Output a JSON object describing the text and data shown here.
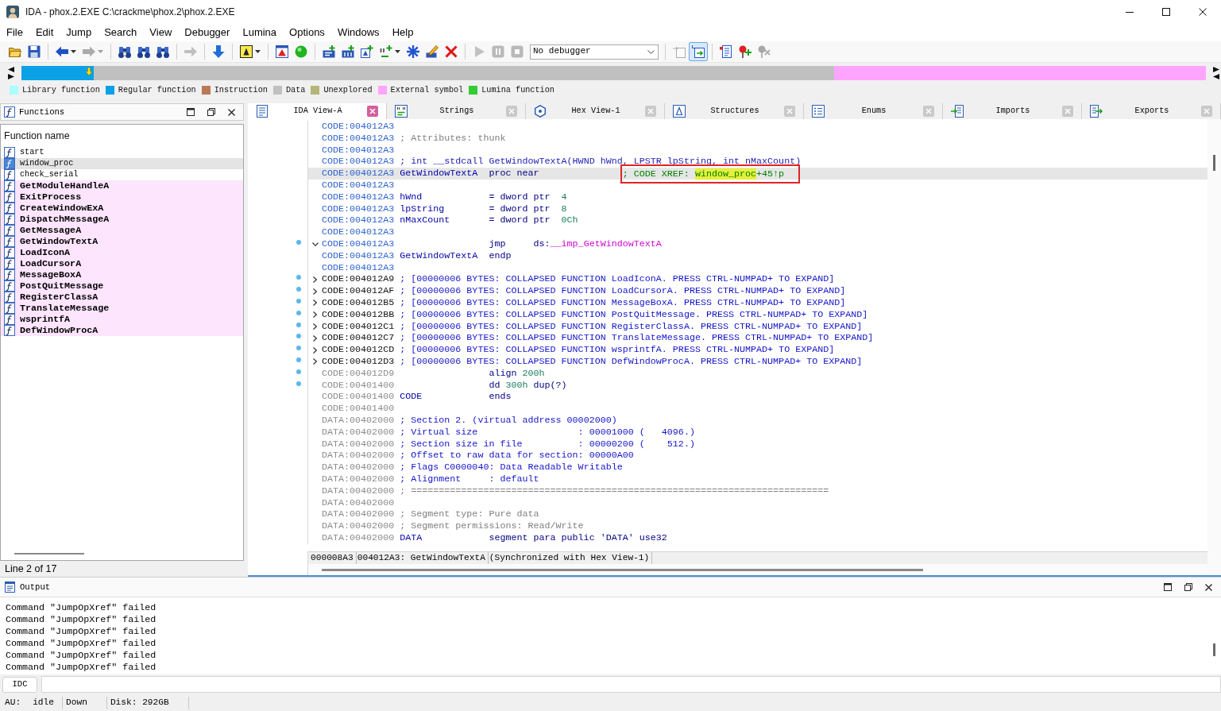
{
  "window": {
    "title": "IDA - phox.2.EXE C:\\crackme\\phox.2\\phox.2.EXE"
  },
  "menu": [
    "File",
    "Edit",
    "Jump",
    "Search",
    "View",
    "Debugger",
    "Lumina",
    "Options",
    "Windows",
    "Help"
  ],
  "toolbar": [
    {
      "kind": "open",
      "disabled": false,
      "pressed": false,
      "dropdown": false
    },
    {
      "kind": "save",
      "disabled": false,
      "pressed": false,
      "dropdown": false
    },
    {
      "kind": "separator"
    },
    {
      "kind": "back",
      "disabled": false,
      "pressed": false,
      "dropdown": true
    },
    {
      "kind": "forward",
      "disabled": true,
      "pressed": false,
      "dropdown": true
    },
    {
      "kind": "separator"
    },
    {
      "kind": "immsearch",
      "disabled": false,
      "pressed": false,
      "dropdown": false
    },
    {
      "kind": "textsearch",
      "disabled": false,
      "pressed": false,
      "dropdown": false
    },
    {
      "kind": "binsearch",
      "disabled": false,
      "pressed": false,
      "dropdown": false
    },
    {
      "kind": "separator"
    },
    {
      "kind": "goto",
      "disabled": true,
      "pressed": false,
      "dropdown": false
    },
    {
      "kind": "separator"
    },
    {
      "kind": "descend",
      "disabled": false,
      "pressed": false,
      "dropdown": false
    },
    {
      "kind": "separator"
    },
    {
      "kind": "rename",
      "disabled": false,
      "pressed": false,
      "dropdown": true
    },
    {
      "kind": "separator"
    },
    {
      "kind": "problems",
      "disabled": false,
      "pressed": false,
      "dropdown": false
    },
    {
      "kind": "status",
      "disabled": false,
      "pressed": false,
      "dropdown": false
    },
    {
      "kind": "separator"
    },
    {
      "kind": "code",
      "disabled": false,
      "pressed": false,
      "dropdown": false
    },
    {
      "kind": "data",
      "disabled": false,
      "pressed": false,
      "dropdown": false
    },
    {
      "kind": "alignment",
      "disabled": false,
      "pressed": false,
      "dropdown": false
    },
    {
      "kind": "strlit",
      "disabled": false,
      "pressed": false,
      "dropdown": true
    },
    {
      "kind": "array",
      "disabled": false,
      "pressed": false,
      "dropdown": false
    },
    {
      "kind": "edit",
      "disabled": false,
      "pressed": false,
      "dropdown": false
    },
    {
      "kind": "undefine",
      "disabled": false,
      "pressed": false,
      "dropdown": false
    },
    {
      "kind": "separator"
    },
    {
      "kind": "run",
      "disabled": true,
      "pressed": false,
      "dropdown": false
    },
    {
      "kind": "pause",
      "disabled": true,
      "pressed": false,
      "dropdown": false
    },
    {
      "kind": "stop",
      "disabled": true,
      "pressed": false,
      "dropdown": false
    },
    {
      "kind": "combo",
      "value": "No debugger"
    },
    {
      "kind": "separator"
    },
    {
      "kind": "source",
      "disabled": true,
      "pressed": false,
      "dropdown": false
    },
    {
      "kind": "sync",
      "disabled": false,
      "pressed": true,
      "dropdown": false
    },
    {
      "kind": "separator"
    },
    {
      "kind": "list",
      "disabled": false,
      "pressed": false,
      "dropdown": false
    },
    {
      "kind": "addbreak",
      "disabled": false,
      "pressed": false,
      "dropdown": false
    },
    {
      "kind": "delbreak",
      "disabled": true,
      "pressed": false,
      "dropdown": false
    }
  ],
  "legend": [
    {
      "label": "Library function",
      "color": "#aaffff"
    },
    {
      "label": "Regular function",
      "color": "#0aa1e6"
    },
    {
      "label": "Instruction",
      "color": "#b97a57"
    },
    {
      "label": "Data",
      "color": "#c0c0c0"
    },
    {
      "label": "Unexplored",
      "color": "#b5b57a"
    },
    {
      "label": "External symbol",
      "color": "#ffa5ff"
    },
    {
      "label": "Lumina function",
      "color": "#32cd32"
    }
  ],
  "functions_panel": {
    "title": "Functions",
    "column": "Function name",
    "rows": [
      {
        "name": "start",
        "kind": "regular",
        "selected": false
      },
      {
        "name": "window_proc",
        "kind": "regular",
        "selected": true
      },
      {
        "name": "check_serial",
        "kind": "regular",
        "selected": false
      },
      {
        "name": "GetModuleHandleA",
        "kind": "external",
        "selected": false
      },
      {
        "name": "ExitProcess",
        "kind": "external",
        "selected": false
      },
      {
        "name": "CreateWindowExA",
        "kind": "external",
        "selected": false
      },
      {
        "name": "DispatchMessageA",
        "kind": "external",
        "selected": false
      },
      {
        "name": "GetMessageA",
        "kind": "external",
        "selected": false
      },
      {
        "name": "GetWindowTextA",
        "kind": "external",
        "selected": false
      },
      {
        "name": "LoadIconA",
        "kind": "external",
        "selected": false
      },
      {
        "name": "LoadCursorA",
        "kind": "external",
        "selected": false
      },
      {
        "name": "MessageBoxA",
        "kind": "external",
        "selected": false
      },
      {
        "name": "PostQuitMessage",
        "kind": "external",
        "selected": false
      },
      {
        "name": "RegisterClassA",
        "kind": "external",
        "selected": false
      },
      {
        "name": "TranslateMessage",
        "kind": "external",
        "selected": false
      },
      {
        "name": "wsprintfA",
        "kind": "external",
        "selected": false
      },
      {
        "name": "DefWindowProcA",
        "kind": "external",
        "selected": false
      }
    ],
    "status": "Line 2 of 17"
  },
  "tabs": [
    {
      "label": "IDA View-A",
      "kind": "disassembly",
      "selected": true
    },
    {
      "label": "Strings",
      "kind": "strings",
      "selected": false
    },
    {
      "label": "Hex View-1",
      "kind": "hex",
      "selected": false
    },
    {
      "label": "Structures",
      "kind": "structures",
      "selected": false
    },
    {
      "label": "Enums",
      "kind": "enums",
      "selected": false
    },
    {
      "label": "Imports",
      "kind": "imports",
      "selected": false
    },
    {
      "label": "Exports",
      "kind": "exports",
      "selected": false
    }
  ],
  "listing": {
    "lines": [
      {
        "address": "CODE:004012A3",
        "kind": "function",
        "selected": false,
        "marker": false
      },
      {
        "address": "CODE:004012A3",
        "kind": "function",
        "selected": false,
        "marker": false,
        "note": [
          {
            "text": "; Attributes: thunk",
            "kind": "comment"
          }
        ]
      },
      {
        "address": "CODE:004012A3",
        "kind": "function",
        "selected": false,
        "marker": false
      },
      {
        "address": "CODE:004012A3",
        "kind": "function",
        "selected": false,
        "marker": false,
        "note": [
          {
            "text": "; int __stdcall GetWindowTextA(HWND hWnd, LPSTR lpString, int nMaxCount)",
            "kind": "prototype"
          }
        ]
      },
      {
        "address": "CODE:004012A3",
        "kind": "function",
        "selected": true,
        "marker": false,
        "label": "GetWindowTextA",
        "code": [
          {
            "text": "proc near",
            "kind": "keyword"
          }
        ],
        "comment": {
          "boxed": true,
          "tokens": [
            {
              "text": "; CODE XREF: ",
              "kind": "xref",
              "highlighted": false
            },
            {
              "text": "window_proc",
              "kind": "xref",
              "highlighted": true
            },
            {
              "text": "+45↑p",
              "kind": "xref",
              "highlighted": false
            }
          ]
        }
      },
      {
        "address": "CODE:004012A3",
        "kind": "function",
        "selected": false,
        "marker": false
      },
      {
        "address": "CODE:004012A3",
        "kind": "function",
        "selected": false,
        "marker": false,
        "label": "hWnd",
        "code": [
          {
            "text": "= dword ptr  ",
            "kind": "keyword"
          },
          {
            "text": "4",
            "kind": "number"
          }
        ]
      },
      {
        "address": "CODE:004012A3",
        "kind": "function",
        "selected": false,
        "marker": false,
        "label": "lpString",
        "code": [
          {
            "text": "= dword ptr  ",
            "kind": "keyword"
          },
          {
            "text": "8",
            "kind": "number"
          }
        ]
      },
      {
        "address": "CODE:004012A3",
        "kind": "function",
        "selected": false,
        "marker": false,
        "label": "nMaxCount",
        "code": [
          {
            "text": "= dword ptr  ",
            "kind": "keyword"
          },
          {
            "text": "0Ch",
            "kind": "number"
          }
        ]
      },
      {
        "address": "CODE:004012A3",
        "kind": "function",
        "selected": false,
        "marker": false
      },
      {
        "address": "CODE:004012A3",
        "kind": "function",
        "selected": false,
        "marker": true,
        "expanded": true,
        "code": [
          {
            "text": "jmp     ds:",
            "kind": "keyword"
          },
          {
            "text": "__imp_GetWindowTextA",
            "kind": "import"
          }
        ]
      },
      {
        "address": "CODE:004012A3",
        "kind": "function",
        "selected": false,
        "marker": false,
        "label": "GetWindowTextA",
        "code": [
          {
            "text": "endp",
            "kind": "keyword"
          }
        ]
      },
      {
        "address": "CODE:004012A3",
        "kind": "function",
        "selected": false,
        "marker": false
      },
      {
        "address": "CODE:004012A9",
        "kind": "collapsed",
        "selected": false,
        "marker": true,
        "expanded": false,
        "note": [
          {
            "text": "; [00000006 BYTES: COLLAPSED FUNCTION LoadIconA. PRESS CTRL-NUMPAD+ TO EXPAND]",
            "kind": "collapsed"
          }
        ]
      },
      {
        "address": "CODE:004012AF",
        "kind": "collapsed",
        "selected": false,
        "marker": true,
        "expanded": false,
        "note": [
          {
            "text": "; [00000006 BYTES: COLLAPSED FUNCTION LoadCursorA. PRESS CTRL-NUMPAD+ TO EXPAND]",
            "kind": "collapsed"
          }
        ]
      },
      {
        "address": "CODE:004012B5",
        "kind": "collapsed",
        "selected": false,
        "marker": true,
        "expanded": false,
        "note": [
          {
            "text": "; [00000006 BYTES: COLLAPSED FUNCTION MessageBoxA. PRESS CTRL-NUMPAD+ TO EXPAND]",
            "kind": "collapsed"
          }
        ]
      },
      {
        "address": "CODE:004012BB",
        "kind": "collapsed",
        "selected": false,
        "marker": true,
        "expanded": false,
        "note": [
          {
            "text": "; [00000006 BYTES: COLLAPSED FUNCTION PostQuitMessage. PRESS CTRL-NUMPAD+ TO EXPAND]",
            "kind": "collapsed"
          }
        ]
      },
      {
        "address": "CODE:004012C1",
        "kind": "collapsed",
        "selected": false,
        "marker": true,
        "expanded": false,
        "note": [
          {
            "text": "; [00000006 BYTES: COLLAPSED FUNCTION RegisterClassA. PRESS CTRL-NUMPAD+ TO EXPAND]",
            "kind": "collapsed"
          }
        ]
      },
      {
        "address": "CODE:004012C7",
        "kind": "collapsed",
        "selected": false,
        "marker": true,
        "expanded": false,
        "note": [
          {
            "text": "; [00000006 BYTES: COLLAPSED FUNCTION TranslateMessage. PRESS CTRL-NUMPAD+ TO EXPAND]",
            "kind": "collapsed"
          }
        ]
      },
      {
        "address": "CODE:004012CD",
        "kind": "collapsed",
        "selected": false,
        "marker": true,
        "expanded": false,
        "note": [
          {
            "text": "; [00000006 BYTES: COLLAPSED FUNCTION wsprintfA. PRESS CTRL-NUMPAD+ TO EXPAND]",
            "kind": "collapsed"
          }
        ]
      },
      {
        "address": "CODE:004012D3",
        "kind": "collapsed",
        "selected": false,
        "marker": true,
        "expanded": false,
        "note": [
          {
            "text": "; [00000006 BYTES: COLLAPSED FUNCTION DefWindowProcA. PRESS CTRL-NUMPAD+ TO EXPAND]",
            "kind": "collapsed"
          }
        ]
      },
      {
        "address": "CODE:004012D9",
        "kind": "plain",
        "selected": false,
        "marker": true,
        "code": [
          {
            "text": "align ",
            "kind": "keyword"
          },
          {
            "text": "200h",
            "kind": "number"
          }
        ]
      },
      {
        "address": "CODE:00401400",
        "kind": "plain",
        "selected": false,
        "marker": true,
        "code": [
          {
            "text": "dd ",
            "kind": "keyword"
          },
          {
            "text": "300h",
            "kind": "number"
          },
          {
            "text": " dup(?)",
            "kind": "keyword"
          }
        ]
      },
      {
        "address": "CODE:00401400",
        "kind": "plain",
        "selected": false,
        "marker": false,
        "label": "CODE",
        "code": [
          {
            "text": "ends",
            "kind": "keyword"
          }
        ]
      },
      {
        "address": "CODE:00401400",
        "kind": "plain",
        "selected": false,
        "marker": false
      },
      {
        "address": "DATA:00402000",
        "kind": "plain",
        "selected": false,
        "marker": false,
        "note": [
          {
            "text": "; Section 2. (virtual address 00002000)",
            "kind": "section"
          }
        ]
      },
      {
        "address": "DATA:00402000",
        "kind": "plain",
        "selected": false,
        "marker": false,
        "note": [
          {
            "text": "; Virtual size                  : 00001000 (   4096.)",
            "kind": "section"
          }
        ]
      },
      {
        "address": "DATA:00402000",
        "kind": "plain",
        "selected": false,
        "marker": false,
        "note": [
          {
            "text": "; Section size in file          : 00000200 (    512.)",
            "kind": "section"
          }
        ]
      },
      {
        "address": "DATA:00402000",
        "kind": "plain",
        "selected": false,
        "marker": false,
        "note": [
          {
            "text": "; Offset to raw data for section: 00000A00",
            "kind": "section"
          }
        ]
      },
      {
        "address": "DATA:00402000",
        "kind": "plain",
        "selected": false,
        "marker": false,
        "note": [
          {
            "text": "; Flags C0000040: Data Readable Writable",
            "kind": "section"
          }
        ]
      },
      {
        "address": "DATA:00402000",
        "kind": "plain",
        "selected": false,
        "marker": false,
        "note": [
          {
            "text": "; Alignment     : default",
            "kind": "section"
          }
        ]
      },
      {
        "address": "DATA:00402000",
        "kind": "plain",
        "selected": false,
        "marker": false,
        "note": [
          {
            "text": "; ===========================================================================",
            "kind": "comment"
          }
        ]
      },
      {
        "address": "DATA:00402000",
        "kind": "plain",
        "selected": false,
        "marker": false
      },
      {
        "address": "DATA:00402000",
        "kind": "plain",
        "selected": false,
        "marker": false,
        "note": [
          {
            "text": "; Segment type: Pure data",
            "kind": "comment"
          }
        ]
      },
      {
        "address": "DATA:00402000",
        "kind": "plain",
        "selected": false,
        "marker": false,
        "note": [
          {
            "text": "; Segment permissions: Read/Write",
            "kind": "comment"
          }
        ]
      },
      {
        "address": "DATA:00402000",
        "kind": "plain",
        "selected": false,
        "marker": false,
        "label": "DATA",
        "code": [
          {
            "text": "segment para public 'DATA' use32",
            "kind": "keyword"
          }
        ]
      }
    ],
    "status": [
      "000008A3",
      "004012A3: GetWindowTextA",
      "(Synchronized with Hex View-1)"
    ]
  },
  "output": {
    "title": "Output",
    "lines": [
      "Command \"JumpOpXref\" failed",
      "Command \"JumpOpXref\" failed",
      "Command \"JumpOpXref\" failed",
      "Command \"JumpOpXref\" failed",
      "Command \"JumpOpXref\" failed",
      "Command \"JumpOpXref\" failed"
    ]
  },
  "command_line": {
    "language": "IDC"
  },
  "status_bar": {
    "au_label": "AU:",
    "au_state": "idle",
    "direction": "Down",
    "disk": "Disk: 292GB"
  }
}
